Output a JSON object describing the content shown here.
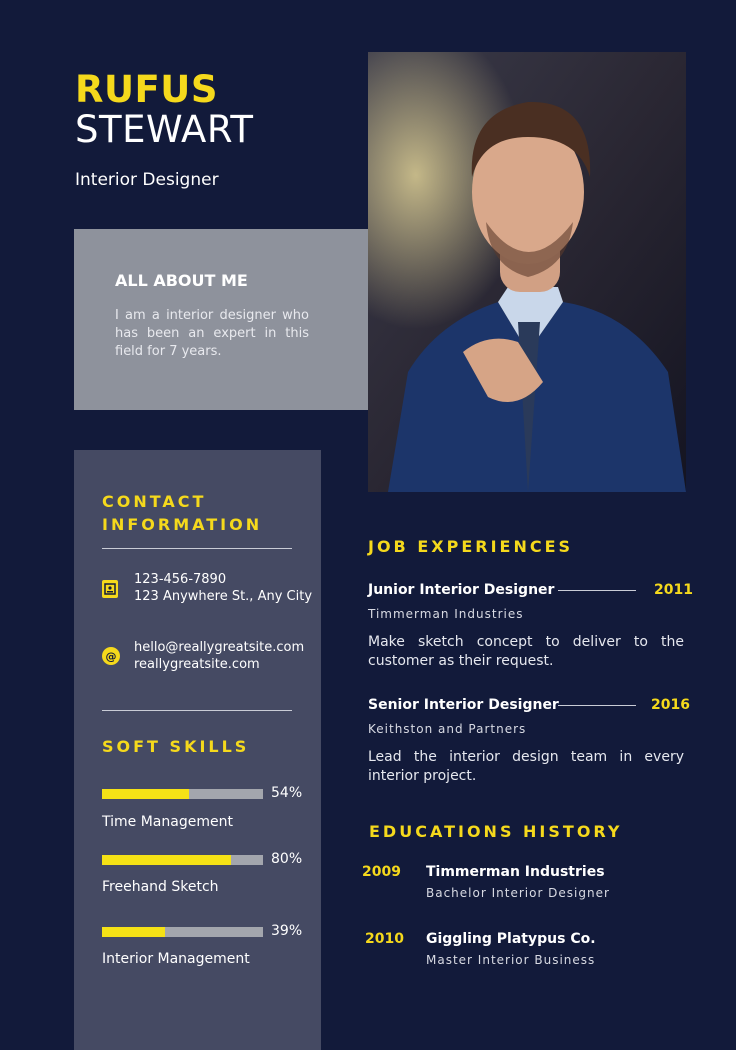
{
  "name": {
    "first": "RUFUS",
    "last": "STEWART"
  },
  "role": "Interior Designer",
  "about": {
    "title": "ALL ABOUT ME",
    "text": "I am a interior designer who has been an expert in this field for 7 years."
  },
  "contact": {
    "title": "CONTACT INFORMATION",
    "phone": "123-456-7890",
    "address": "123 Anywhere St., Any City",
    "email": "hello@reallygreatsite.com",
    "website": "reallygreatsite.com"
  },
  "skills": {
    "title": "SOFT SKILLS",
    "items": [
      {
        "name": "Time Management",
        "percent_label": "54%",
        "level": 0.54
      },
      {
        "name": "Freehand Sketch",
        "percent_label": "80%",
        "level": 0.8
      },
      {
        "name": "Interior Management",
        "percent_label": "39%",
        "level": 0.39
      }
    ]
  },
  "jobs": {
    "title": "JOB EXPERIENCES",
    "items": [
      {
        "title": "Junior Interior Designer",
        "year": "2011",
        "company": "Timmerman Industries",
        "description": "Make sketch concept to deliver to the customer as their request."
      },
      {
        "title": "Senior Interior Designer",
        "year": "2016",
        "company": "Keithston and Partners",
        "description": "Lead the interior design team in every interior project."
      }
    ]
  },
  "education": {
    "title": "EDUCATIONS HISTORY",
    "items": [
      {
        "year": "2009",
        "school": "Timmerman Industries",
        "degree": "Bachelor Interior Designer"
      },
      {
        "year": "2010",
        "school": "Giggling Platypus Co.",
        "degree": "Master Interior Business"
      }
    ]
  },
  "colors": {
    "background": "#121a3a",
    "accent": "#f5d91c",
    "sidebar": "#454a63",
    "about_box": "#8e929c"
  },
  "icons": {
    "phone": "contact-card-icon",
    "email": "at-sign-icon"
  }
}
